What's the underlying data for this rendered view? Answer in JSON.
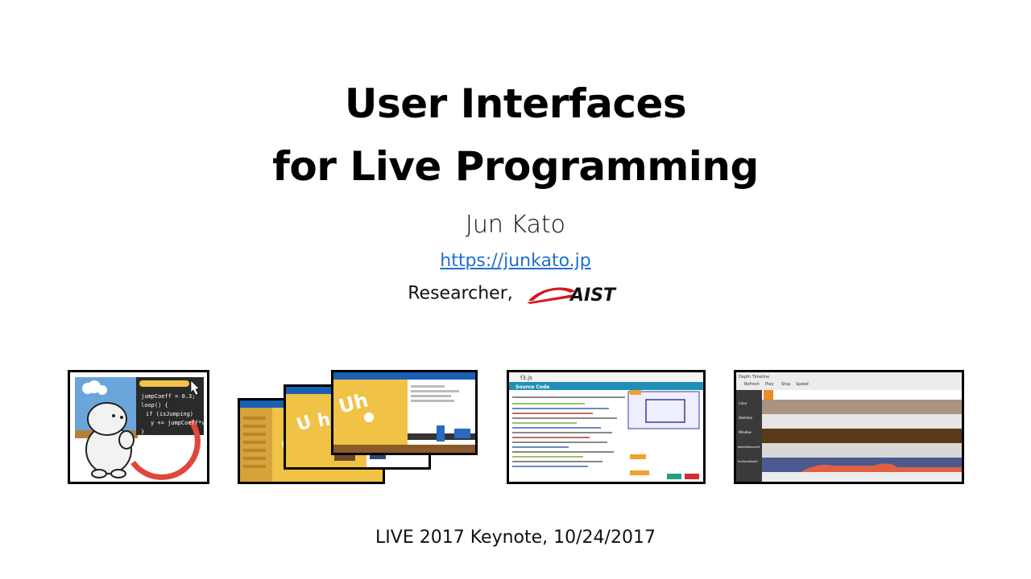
{
  "slide": {
    "title_line1": "User Interfaces",
    "title_line2": "for Live Programming",
    "author": "Jun Kato",
    "url": "https://junkato.jp",
    "affiliation_prefix": "Researcher,",
    "org_logo_text": "AIST",
    "footer": "LIVE 2017 Keynote, 10/24/2017"
  },
  "thumbnails": {
    "code_snippet": [
      "jumpCoeff = 0.3;",
      "loop() {",
      "if (isJumping)",
      "y += jumpCoeff*v;",
      "}"
    ],
    "code_highlight": "0.3",
    "tab_label": "Source Code",
    "file_label": "f3.js",
    "timeline_title": "Depth Timeline",
    "timeline_buttons": [
      "Refresh",
      "Play",
      "Stop"
    ],
    "timeline_speed_label": "Speed",
    "timeline_rows": [
      "Color",
      "Skeleton",
      "Window",
      "depthDistanceR",
      "SurfaceDepth"
    ]
  },
  "colors": {
    "link": "#1f6fd0",
    "aist_red": "#d6171f",
    "pen_yellow": "#f0c245",
    "ui_blue": "#1a5fb4"
  }
}
